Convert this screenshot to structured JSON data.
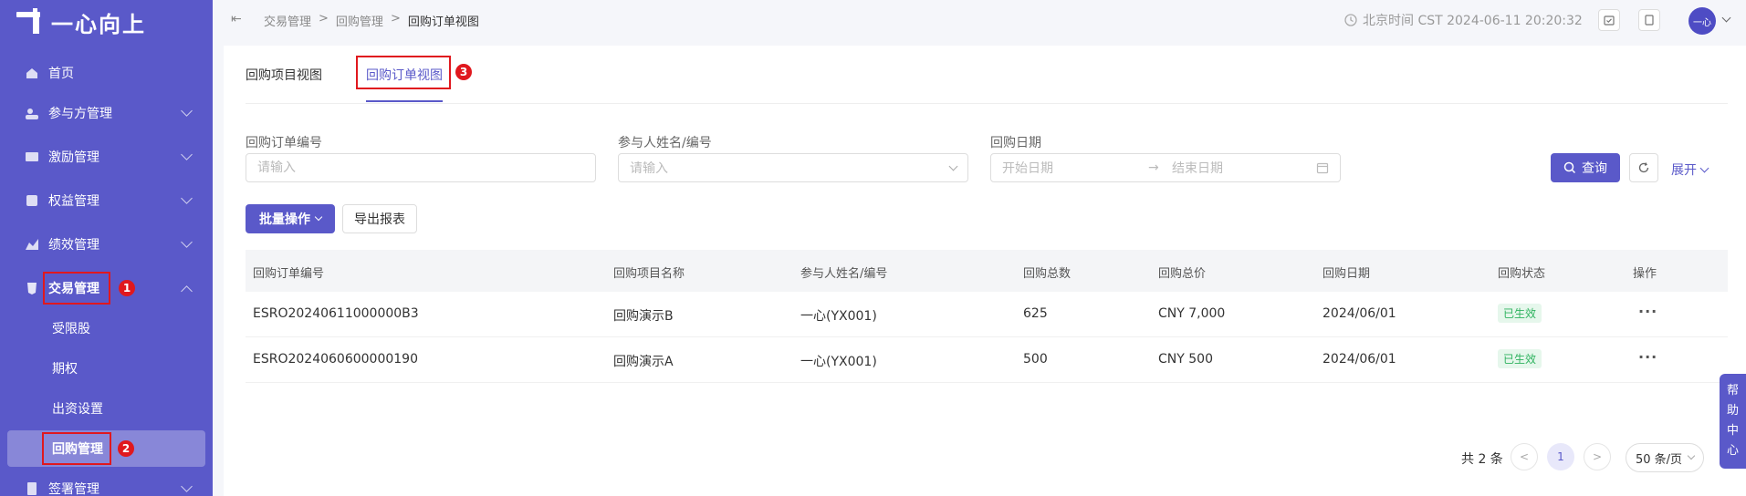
{
  "app": {
    "logo_text": "一心向上"
  },
  "sidebar": {
    "items": [
      {
        "label": "首页",
        "icon": "home-icon"
      },
      {
        "label": "参与方管理",
        "icon": "people-icon"
      },
      {
        "label": "激励管理",
        "icon": "incentive-icon"
      },
      {
        "label": "权益管理",
        "icon": "equity-icon"
      },
      {
        "label": "绩效管理",
        "icon": "performance-icon"
      },
      {
        "label": "交易管理",
        "icon": "trade-icon"
      },
      {
        "label": "签署管理",
        "icon": "sign-icon"
      }
    ],
    "sub_items": [
      {
        "label": "受限股"
      },
      {
        "label": "期权"
      },
      {
        "label": "出资设置"
      },
      {
        "label": "回购管理"
      }
    ]
  },
  "annotations": {
    "badge1": "1",
    "badge2": "2",
    "badge3": "3"
  },
  "header": {
    "breadcrumb": [
      "交易管理",
      "回购管理",
      "回购订单视图"
    ],
    "separator": ">",
    "clock": "北京时间 CST 2024-06-11 20:20:32",
    "avatar_text": "一心"
  },
  "tabs": [
    {
      "label": "回购项目视图"
    },
    {
      "label": "回购订单视图"
    }
  ],
  "filters": {
    "order_no_label": "回购订单编号",
    "order_no_placeholder": "请输入",
    "participant_label": "参与人姓名/编号",
    "participant_placeholder": "请输入",
    "date_label": "回购日期",
    "start_placeholder": "开始日期",
    "end_placeholder": "结束日期",
    "date_arrow": "→",
    "query_label": "查询",
    "expand_label": "展开"
  },
  "toolbar": {
    "batch_label": "批量操作",
    "export_label": "导出报表"
  },
  "table": {
    "headers": [
      "回购订单编号",
      "回购项目名称",
      "参与人姓名/编号",
      "回购总数",
      "回购总价",
      "回购日期",
      "回购状态",
      "操作"
    ],
    "rows": [
      {
        "order_no": "ESRO20240611000000B3",
        "project": "回购演示B",
        "participant": "一心(YX001)",
        "count": "625",
        "price": "CNY 7,000",
        "date": "2024/06/01",
        "status": "已生效",
        "action": "···"
      },
      {
        "order_no": "ESRO2024060600000190",
        "project": "回购演示A",
        "participant": "一心(YX001)",
        "count": "500",
        "price": "CNY 500",
        "date": "2024/06/01",
        "status": "已生效",
        "action": "···"
      }
    ]
  },
  "pagination": {
    "total_text": "共 2 条",
    "current": "1",
    "page_size": "50 条/页",
    "prev": "<",
    "next": ">"
  },
  "help": {
    "chars": [
      "帮",
      "助",
      "中",
      "心"
    ]
  },
  "colors": {
    "primary": "#5a59c9",
    "annotation": "#e0181e",
    "success": "#2fb35f"
  }
}
